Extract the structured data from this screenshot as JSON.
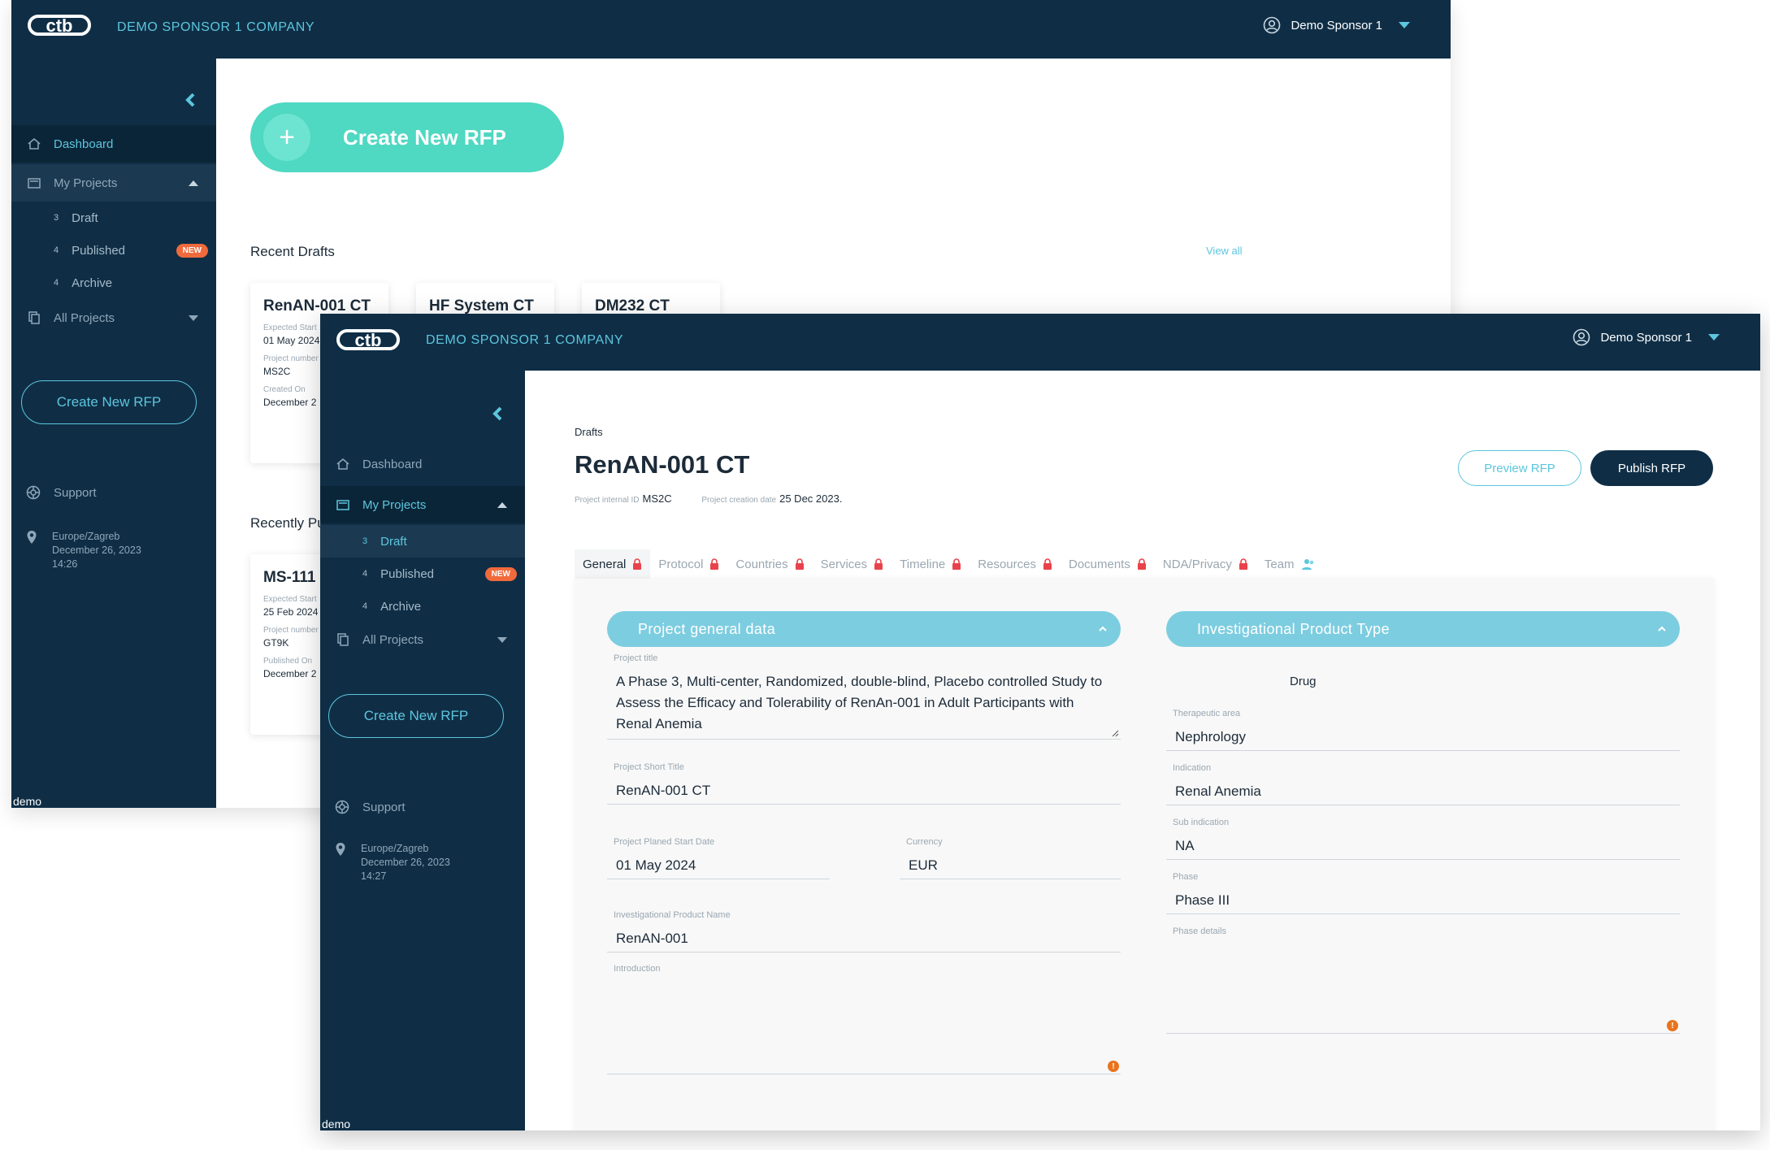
{
  "back_window": {
    "header": {
      "company": "DEMO SPONSOR 1 COMPANY",
      "user": "Demo Sponsor 1"
    },
    "sidebar": {
      "dashboard": "Dashboard",
      "my_projects": "My Projects",
      "draft": {
        "count": "3",
        "label": "Draft"
      },
      "published": {
        "count": "4",
        "label": "Published",
        "badge": "NEW"
      },
      "archive": {
        "count": "4",
        "label": "Archive"
      },
      "all_projects": "All Projects",
      "create_button": "Create New RFP",
      "support": "Support",
      "timezone": "Europe/Zagreb",
      "date": "December 26, 2023",
      "time": "14:26",
      "env": "demo"
    },
    "main": {
      "create_button": "Create New RFP",
      "recent_drafts": "Recent Drafts",
      "view_all": "View all",
      "recently_published": "Recently Pu",
      "drafts": [
        {
          "title": "RenAN-001 CT",
          "l1": "Expected Start",
          "v1": "01 May 2024",
          "l2": "Project number",
          "v2": "MS2C",
          "l3": "Created On",
          "v3": "December 2"
        },
        {
          "title": "HF System CT"
        },
        {
          "title": "DM232 CT"
        }
      ],
      "published_card": {
        "title": "MS-111",
        "l1": "Expected Start",
        "v1": "25 Feb 2024",
        "l2": "Project number",
        "v2": "GT9K",
        "l3": "Published On",
        "v3": "December 2"
      }
    }
  },
  "front_window": {
    "header": {
      "company": "DEMO SPONSOR 1 COMPANY",
      "user": "Demo Sponsor 1"
    },
    "sidebar": {
      "dashboard": "Dashboard",
      "my_projects": "My Projects",
      "draft": {
        "count": "3",
        "label": "Draft"
      },
      "published": {
        "count": "4",
        "label": "Published",
        "badge": "NEW"
      },
      "archive": {
        "count": "4",
        "label": "Archive"
      },
      "all_projects": "All Projects",
      "create_button": "Create New RFP",
      "support": "Support",
      "timezone": "Europe/Zagreb",
      "date": "December 26, 2023",
      "time": "14:27",
      "env": "demo"
    },
    "main": {
      "breadcrumb": "Drafts",
      "title": "RenAN-001 CT",
      "internal_id_label": "Project internal ID",
      "internal_id": "MS2C",
      "creation_date_label": "Project creation date",
      "creation_date": "25 Dec 2023.",
      "preview_button": "Preview RFP",
      "publish_button": "Publish RFP",
      "tabs": [
        "General",
        "Protocol",
        "Countries",
        "Services",
        "Timeline",
        "Resources",
        "Documents",
        "NDA/Privacy",
        "Team"
      ],
      "general_section": "Project general data",
      "product_section": "Investigational Product Type",
      "fields": {
        "project_title_label": "Project title",
        "project_title": "A Phase 3, Multi-center, Randomized, double-blind, Placebo controlled Study to Assess the Efficacy and Tolerability of RenAn-001 in Adult Participants with Renal Anemia",
        "short_title_label": "Project Short Title",
        "short_title": "RenAN-001 CT",
        "start_date_label": "Project Planed Start Date",
        "start_date": "01 May 2024",
        "currency_label": "Currency",
        "currency": "EUR",
        "product_name_label": "Investigational Product Name",
        "product_name": "RenAN-001",
        "introduction_label": "Introduction",
        "product_type": "Drug",
        "therapeutic_area_label": "Therapeutic area",
        "therapeutic_area": "Nephrology",
        "indication_label": "Indication",
        "indication": "Renal Anemia",
        "sub_indication_label": "Sub indication",
        "sub_indication": "NA",
        "phase_label": "Phase",
        "phase": "Phase III",
        "phase_details_label": "Phase details"
      }
    }
  },
  "colors": {
    "navy": "#0f2e46",
    "teal": "#5cc6dd",
    "mint": "#4fd8c2",
    "badge": "#f06a3c"
  }
}
